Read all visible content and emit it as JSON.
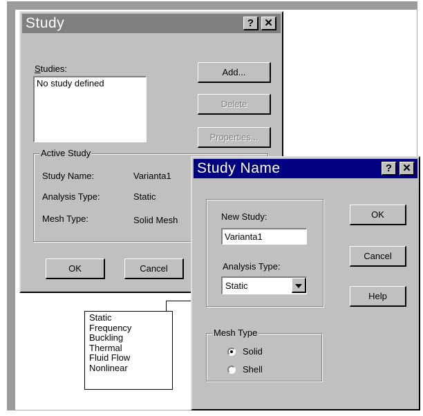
{
  "colors": {
    "window_bg": "#c0c0c0",
    "title_active": "#000080",
    "title_inactive": "#808080",
    "frame": "#9c9c9c"
  },
  "study_dialog": {
    "title": "Study",
    "help_btn": "?",
    "close_btn": "✕",
    "studies_label": "Studies:",
    "studies_list": [
      "No study defined"
    ],
    "add_label": "Add...",
    "delete_label": "Delete",
    "properties_label": "Properties...",
    "active_study": {
      "legend": "Active Study",
      "study_name_label": "Study Name:",
      "study_name_value": "Varianta1",
      "analysis_type_label": "Analysis Type:",
      "analysis_type_value": "Static",
      "mesh_type_label": "Mesh Type:",
      "mesh_type_value": "Solid Mesh"
    },
    "ok_label": "OK",
    "cancel_label": "Cancel"
  },
  "study_name_dialog": {
    "title": "Study Name",
    "help_btn": "?",
    "close_btn": "✕",
    "new_study_label": "New Study:",
    "new_study_value": "Varianta1",
    "analysis_type_label": "Analysis Type:",
    "analysis_type_selected": "Static",
    "ok_label": "OK",
    "cancel_label": "Cancel",
    "help_label": "Help",
    "mesh_type": {
      "legend": "Mesh Type",
      "options": [
        "Solid",
        "Shell"
      ],
      "selected": "Solid"
    }
  },
  "analysis_type_options": [
    "Static",
    "Frequency",
    "Buckling",
    "Thermal",
    "Fluid Flow",
    "Nonlinear"
  ]
}
